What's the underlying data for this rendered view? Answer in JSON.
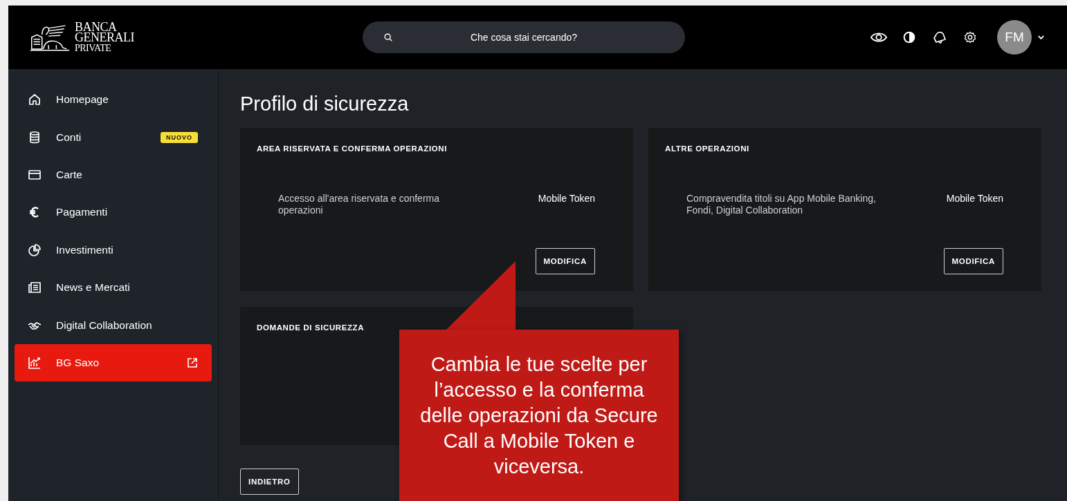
{
  "header": {
    "logo": {
      "line_1": "BANCA",
      "line_2": "GENERALI",
      "line_3": "PRIVATE"
    },
    "search": {
      "placeholder": "Che cosa stai cercando?"
    },
    "avatar": {
      "initials": "FM"
    }
  },
  "sidebar": {
    "items": [
      {
        "label": "Homepage",
        "selected": false
      },
      {
        "label": "Conti",
        "selected": false,
        "badge": "NUOVO"
      },
      {
        "label": "Carte",
        "selected": false
      },
      {
        "label": "Pagamenti",
        "selected": false
      },
      {
        "label": "Investimenti",
        "selected": false
      },
      {
        "label": "News e Mercati",
        "selected": false
      },
      {
        "label": "Digital Collaboration",
        "selected": false
      },
      {
        "label": "BG Saxo",
        "selected": true,
        "external": true
      }
    ]
  },
  "main": {
    "title": "Profilo di sicurezza",
    "cards": [
      {
        "title": "AREA RISERVATA E CONFERMA OPERAZIONI",
        "description": "Accesso all'area riservata e conferma operazioni",
        "value": "Mobile Token",
        "button": "MODIFICA"
      },
      {
        "title": "ALTRE OPERAZIONI",
        "description": "Compravendita titoli su App Mobile Banking, Fondi, Digital Collaboration",
        "value": "Mobile Token",
        "button": "MODIFICA"
      },
      {
        "title": "DOMANDE DI SICUREZZA"
      }
    ],
    "back_button": "INDIETRO"
  },
  "callout": {
    "text": "Cambia le tue scelte per l’accesso e la conferma delle operazioni da Secure Call a Mobile Token e viceversa."
  }
}
